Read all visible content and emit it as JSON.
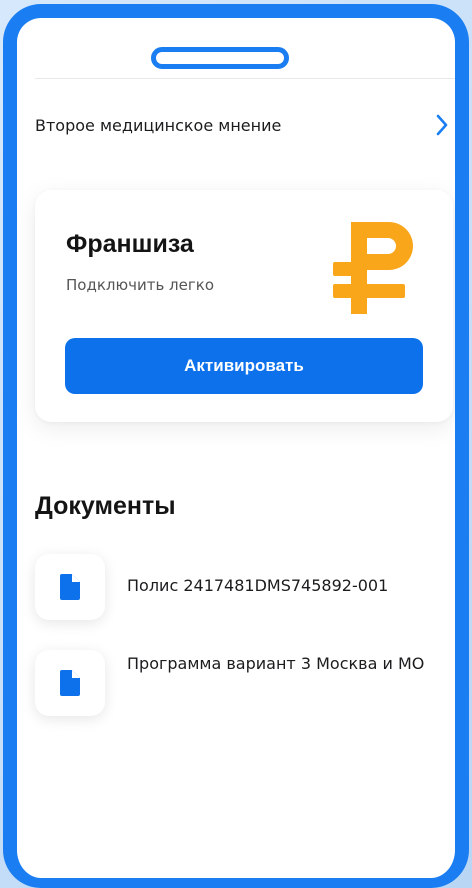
{
  "menu": {
    "second_opinion_label": "Второе медицинское мнение"
  },
  "franchise_card": {
    "title": "Франшиза",
    "subtitle": "Подключить легко",
    "button_label": "Активировать"
  },
  "documents": {
    "section_title": "Документы",
    "items": [
      {
        "label": "Полис 2417481DMS745892-001"
      },
      {
        "label": "Программа вариант 3 Москва и МО"
      }
    ]
  },
  "colors": {
    "accent_blue": "#0d71ec",
    "frame_blue": "#1a7ef2",
    "ruble_orange": "#f9a61b"
  },
  "icons": {
    "chevron": "chevron-right-icon",
    "ruble": "ruble-icon",
    "document": "document-icon"
  }
}
